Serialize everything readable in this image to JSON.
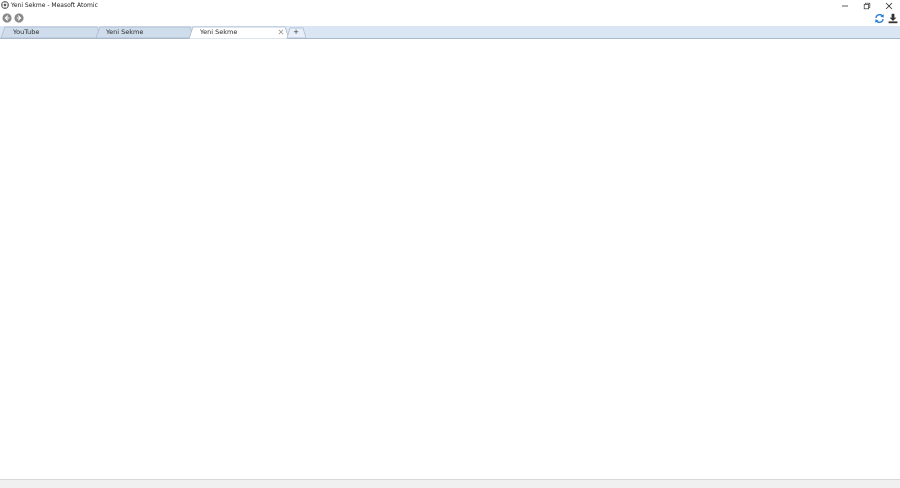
{
  "window": {
    "title": "Yeni Sekme - Measoft Atomic",
    "controls": {
      "minimize_icon": "minimize-icon",
      "maximize_icon": "restore-icon",
      "close_icon": "close-icon"
    }
  },
  "toolbar": {
    "back_icon": "arrow-left-circle-icon",
    "forward_icon": "arrow-right-circle-icon",
    "refresh_icon": "refresh-icon",
    "download_icon": "download-icon"
  },
  "tabs": [
    {
      "label": "YouTube",
      "active": false
    },
    {
      "label": "Yeni Sekme",
      "active": false
    },
    {
      "label": "Yeni Sekme",
      "active": true
    }
  ],
  "new_tab_label": "+",
  "colors": {
    "tabstrip_bg": "#dbe6f4",
    "tab_inactive": "#cfdcec",
    "tab_active": "#ffffff",
    "accent_blue": "#2a7fd4"
  }
}
